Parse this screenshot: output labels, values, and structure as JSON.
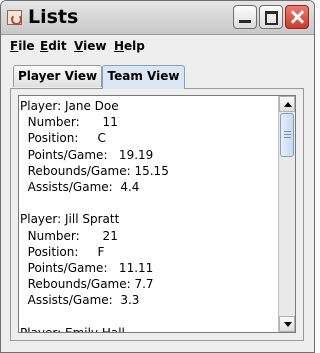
{
  "window": {
    "title": "Lists"
  },
  "menubar": {
    "items": [
      "File",
      "Edit",
      "View",
      "Help"
    ]
  },
  "tabs": [
    {
      "label": "Player View",
      "selected": false
    },
    {
      "label": "Team View",
      "selected": true
    }
  ],
  "list": {
    "lines": [
      "Player: Jane Doe",
      "  Number:      11",
      "  Position:     C",
      "  Points/Game:   19.19",
      "  Rebounds/Game: 15.15",
      "  Assists/Game:  4.4",
      "",
      "Player: Jill Spratt",
      "  Number:      21",
      "  Position:     F",
      "  Points/Game:   11.11",
      "  Rebounds/Game: 7.7",
      "  Assists/Game:  3.3",
      "",
      "Player: Emily Hall"
    ]
  },
  "icons": {
    "app": "java-cup-icon",
    "minimize": "minimize-icon",
    "maximize": "maximize-icon",
    "close": "close-icon",
    "scroll_up": "scroll-up-arrow-icon",
    "scroll_down": "scroll-down-arrow-icon"
  },
  "colors": {
    "close_button": "#d84a38",
    "selected_tab": "#dbe6f3"
  }
}
